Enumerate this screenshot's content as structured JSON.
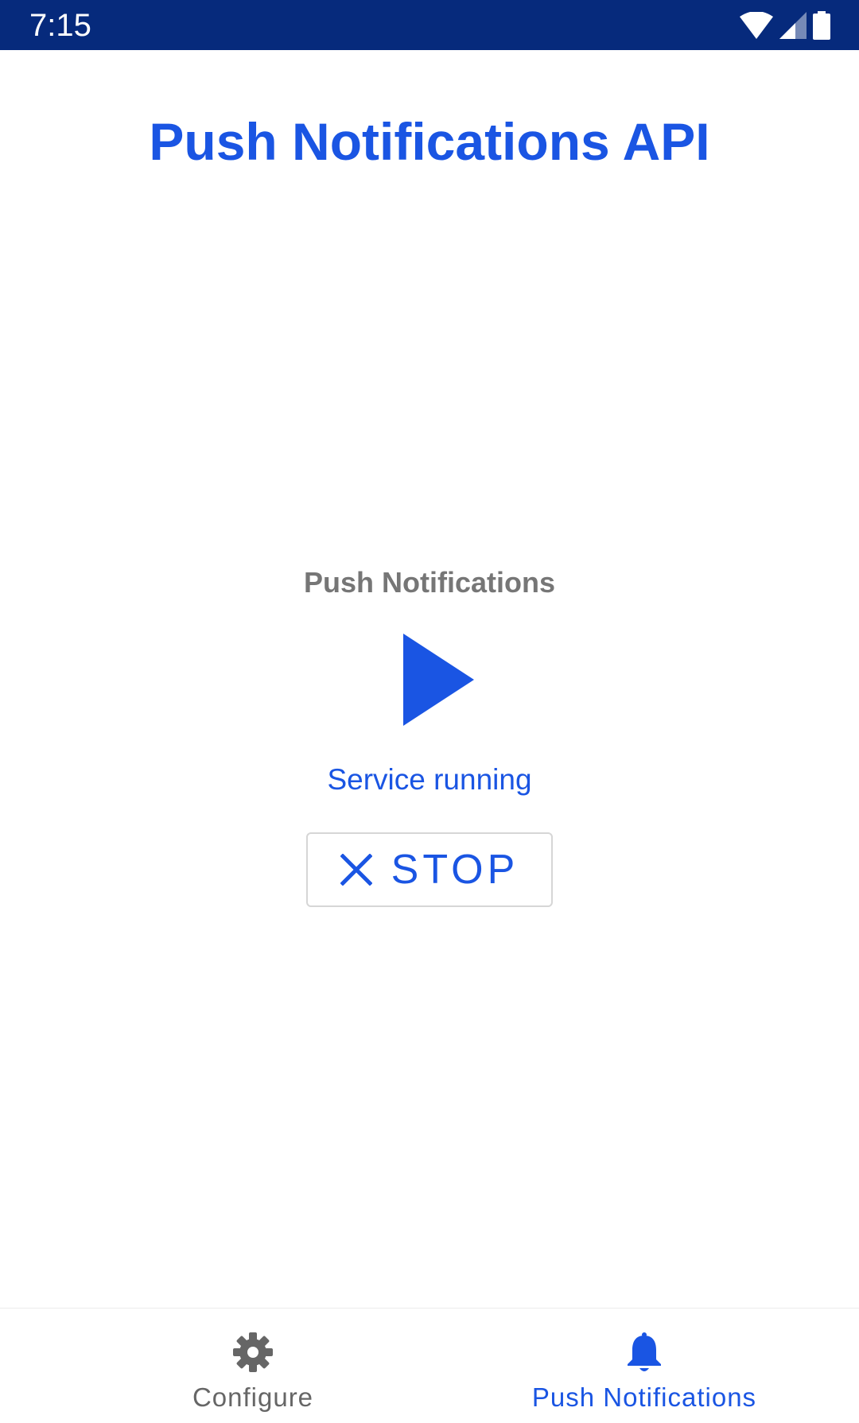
{
  "status_bar": {
    "time": "7:15",
    "icons": [
      "wifi-icon",
      "cell-signal-icon",
      "battery-icon"
    ]
  },
  "page": {
    "title": "Push Notifications API"
  },
  "service": {
    "label": "Push Notifications",
    "play_icon": "play-icon",
    "status_text": "Service running",
    "stop_button_label": "STOP",
    "stop_icon": "close-icon"
  },
  "bottom_nav": {
    "items": [
      {
        "label": "Configure",
        "icon": "gear-icon",
        "active": false
      },
      {
        "label": "Push Notifications",
        "icon": "bell-icon",
        "active": true
      }
    ]
  },
  "colors": {
    "status_bar": "#062a7c",
    "accent": "#1a55e3",
    "muted_text": "#767676",
    "inactive_nav": "#666666",
    "button_border": "#d6d6d6"
  }
}
